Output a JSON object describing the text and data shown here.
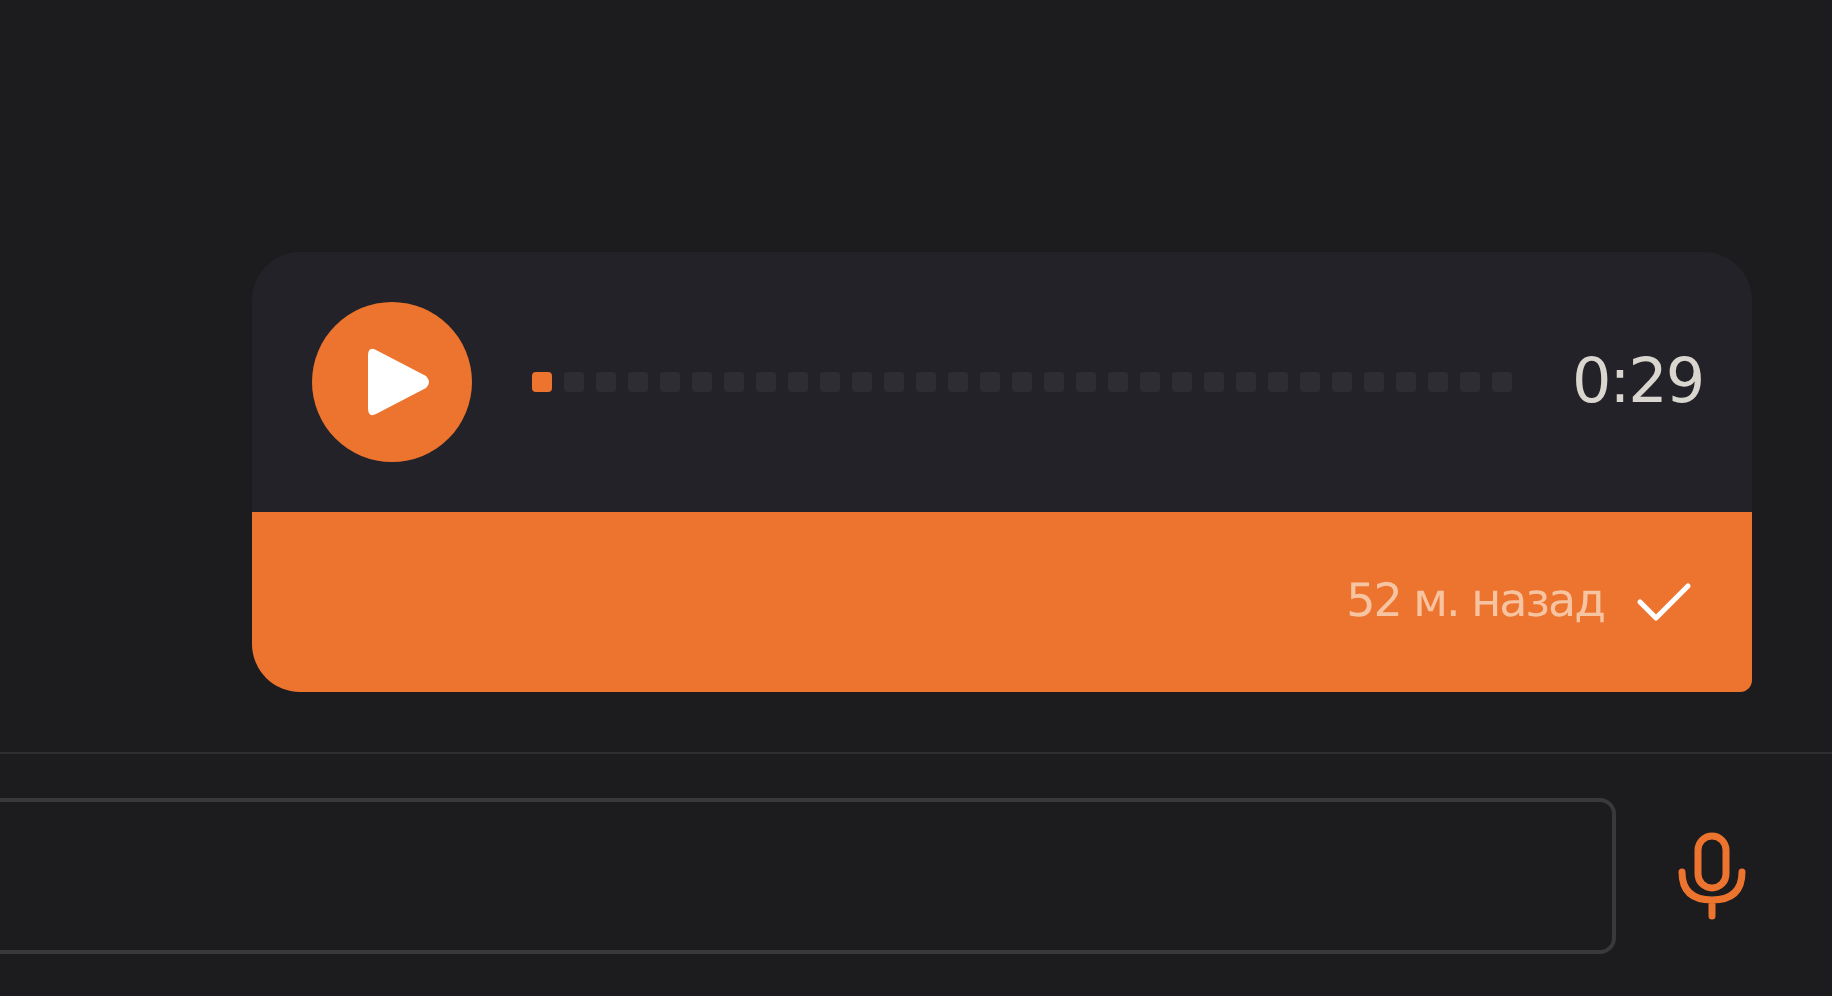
{
  "messages": [
    {
      "kind": "voice",
      "playing": false,
      "duration": "0:29",
      "level": 0.03,
      "time": "52 м. назад",
      "delivered": true
    }
  ]
}
